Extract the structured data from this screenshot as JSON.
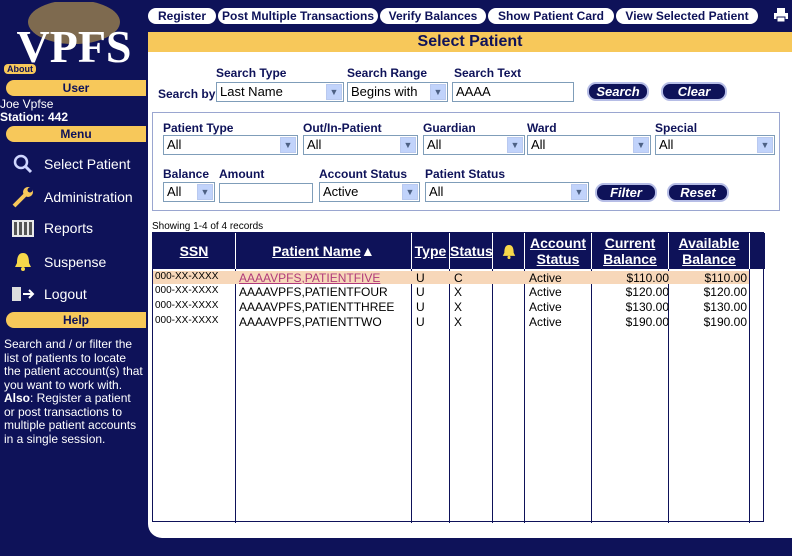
{
  "sidebar": {
    "logo_text": "VPFS",
    "about_label": "About",
    "user_header": "User",
    "user_name": "Joe Vpfse",
    "station": "Station: 442",
    "menu_header": "Menu",
    "menu_items": [
      {
        "label": "Select Patient",
        "icon": "magnifier-icon"
      },
      {
        "label": "Administration",
        "icon": "wrench-icon"
      },
      {
        "label": "Reports",
        "icon": "reports-icon"
      },
      {
        "label": "Suspense",
        "icon": "bell-icon"
      },
      {
        "label": "Logout",
        "icon": "logout-icon"
      }
    ],
    "help_header": "Help",
    "help_text_1": "Search and / or filter the list of patients to locate the patient account(s) that you want to work with. ",
    "help_text_bold": "Also",
    "help_text_2": ": Register a patient or post transactions to multiple patient accounts in a single session."
  },
  "topnav": {
    "buttons": [
      "Register",
      "Post Multiple Transactions",
      "Verify Balances",
      "Show Patient Card",
      "View Selected Patient"
    ]
  },
  "main": {
    "title": "Select Patient",
    "search": {
      "search_by_label": "Search by",
      "type_label": "Search Type",
      "type_value": "Last Name",
      "range_label": "Search Range",
      "range_value": "Begins with",
      "text_label": "Search Text",
      "text_value": "AAAA",
      "search_btn": "Search",
      "clear_btn": "Clear"
    },
    "filters": {
      "patient_type_label": "Patient Type",
      "patient_type_value": "All",
      "outin_label": "Out/In-Patient",
      "outin_value": "All",
      "guardian_label": "Guardian",
      "guardian_value": "All",
      "ward_label": "Ward",
      "ward_value": "All",
      "special_label": "Special",
      "special_value": "All",
      "balance_label": "Balance",
      "balance_value": "All",
      "amount_label": "Amount",
      "amount_value": "",
      "account_status_label": "Account Status",
      "account_status_value": "Active",
      "patient_status_label": "Patient Status",
      "patient_status_value": "All",
      "filter_btn": "Filter",
      "reset_btn": "Reset"
    },
    "showing": "Showing 1-4 of 4 records",
    "table": {
      "headers": {
        "ssn": "SSN",
        "name": "Patient Name",
        "sort_arrow": "▲",
        "type": "Type",
        "status": "Status",
        "acct1": "Account",
        "acct2": "Status",
        "cur1": "Current",
        "cur2": "Balance",
        "avail1": "Available",
        "avail2": "Balance"
      },
      "rows": [
        {
          "ssn": "000-XX-XXXX",
          "name": "AAAAVPFS,PATIENTFIVE",
          "type": "U",
          "status": "C",
          "account_status": "Active",
          "current": "$110.00",
          "available": "$110.00"
        },
        {
          "ssn": "000-XX-XXXX",
          "name": "AAAAVPFS,PATIENTFOUR",
          "type": "U",
          "status": "X",
          "account_status": "Active",
          "current": "$120.00",
          "available": "$120.00"
        },
        {
          "ssn": "000-XX-XXXX",
          "name": "AAAAVPFS,PATIENTTHREE",
          "type": "U",
          "status": "X",
          "account_status": "Active",
          "current": "$130.00",
          "available": "$130.00"
        },
        {
          "ssn": "000-XX-XXXX",
          "name": "AAAAVPFS,PATIENTTWO",
          "type": "U",
          "status": "X",
          "account_status": "Active",
          "current": "$190.00",
          "available": "$190.00"
        }
      ]
    }
  },
  "colors": {
    "navy": "#0e1259",
    "gold": "#f7c85a",
    "selected_row": "#f7d7b9"
  }
}
